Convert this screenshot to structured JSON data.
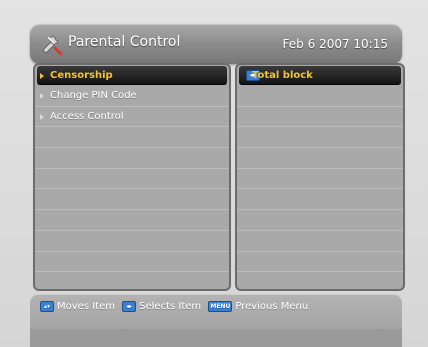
{
  "header": {
    "title": "Parental Control",
    "datetime": "Feb 6 2007 10:15",
    "icon": "wrench-screwdriver-icon"
  },
  "menu": {
    "items": [
      {
        "label": "Censorship",
        "selected": true
      },
      {
        "label": "Change PIN Code",
        "selected": false
      },
      {
        "label": "Access Control",
        "selected": false
      }
    ]
  },
  "options": {
    "items": [
      {
        "label": "Total block",
        "selected": true,
        "icon": "left-right-arrows-icon"
      }
    ]
  },
  "footer": {
    "move_label": "Moves Item",
    "select_label": "Selects Item",
    "menu_key": "MENU",
    "previous_label": "Previous Menu",
    "key_color": "#3a7fd0"
  },
  "colors": {
    "highlight_text": "#f2c22f",
    "panel": "#a9a9a9",
    "header": "#8c8c8c"
  }
}
